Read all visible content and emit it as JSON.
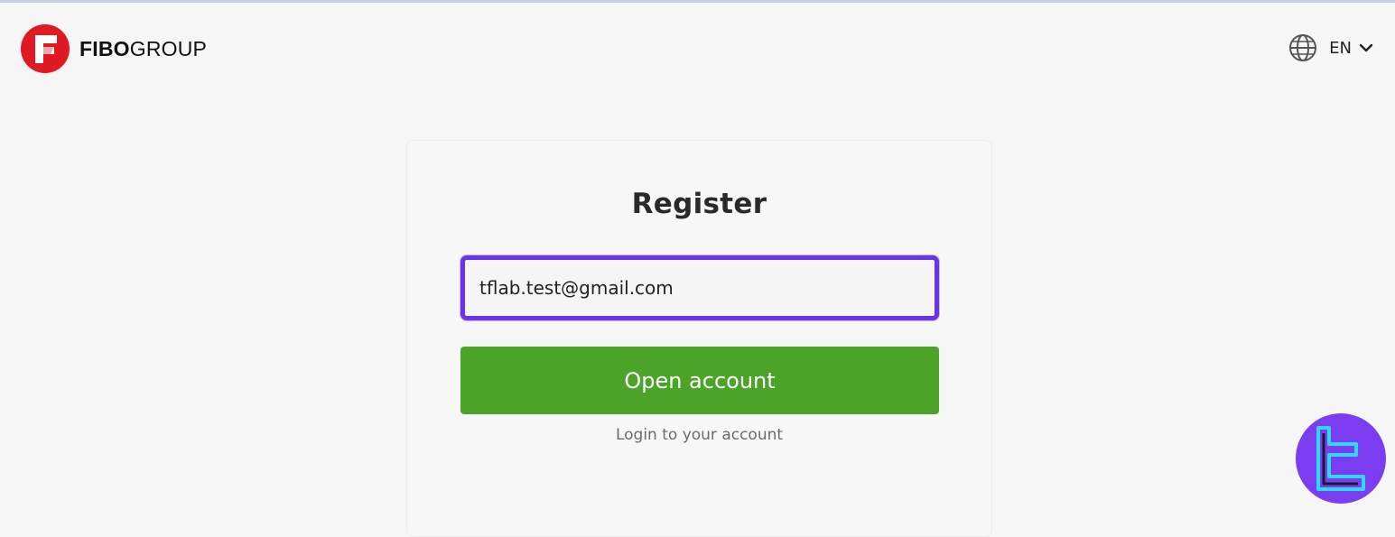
{
  "brand": {
    "logo_bold": "FIBO",
    "logo_regular": "GROUP",
    "logo_color": "#e01a22"
  },
  "header": {
    "language_label": "EN",
    "language_icon": "globe-icon",
    "dropdown_icon": "chevron-down-icon"
  },
  "register": {
    "title": "Register",
    "email_value": "tflab.test@gmail.com",
    "open_account_label": "Open account",
    "login_link": "Login to your account"
  },
  "colors": {
    "focus_border": "#6a35e6",
    "primary_button": "#4ba327",
    "badge": "#7b3df0",
    "badge_accent": "#2fd8f5"
  },
  "watermark": {
    "icon": "tradingfinder-badge-icon"
  }
}
